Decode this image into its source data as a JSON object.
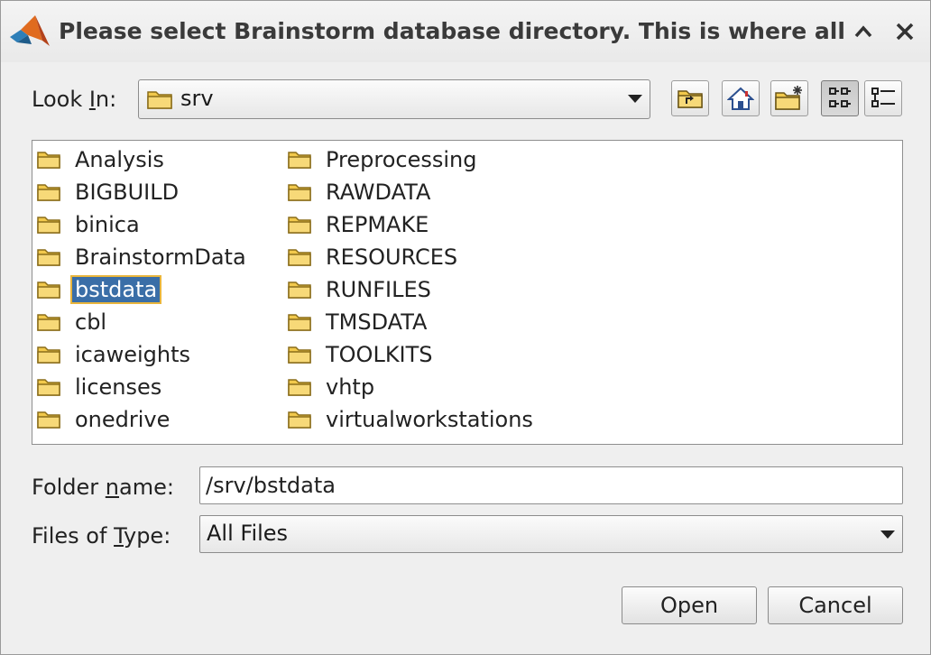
{
  "window": {
    "title": "Please select Brainstorm database directory.  This is where all t"
  },
  "look_in": {
    "label_pre": "Look ",
    "label_key": "I",
    "label_post": "n:",
    "value": "srv"
  },
  "toolbar": {
    "up_folder": "folder-up-icon",
    "home": "home-icon",
    "new_folder": "new-folder-icon",
    "list_view": "list-view-icon",
    "details_view": "details-view-icon"
  },
  "files": {
    "column1": [
      "Analysis",
      "BIGBUILD",
      "binica",
      "BrainstormData",
      "bstdata",
      "cbl",
      "icaweights",
      "licenses",
      "onedrive"
    ],
    "column2": [
      "Preprocessing",
      "RAWDATA",
      "REPMAKE",
      "RESOURCES",
      "RUNFILES",
      "TMSDATA",
      "TOOLKITS",
      "vhtp",
      "virtualworkstations"
    ],
    "selected": "bstdata"
  },
  "folder_name": {
    "label_pre": "Folder ",
    "label_key": "n",
    "label_post": "ame:",
    "value": "/srv/bstdata"
  },
  "files_of_type": {
    "label_pre": "Files of ",
    "label_key": "T",
    "label_post": "ype:",
    "value": "All Files"
  },
  "buttons": {
    "open": "Open",
    "cancel": "Cancel"
  },
  "colors": {
    "selection": "#3a6ea7",
    "focus_outline": "#e9b53c",
    "folder": "#f2c94c"
  }
}
